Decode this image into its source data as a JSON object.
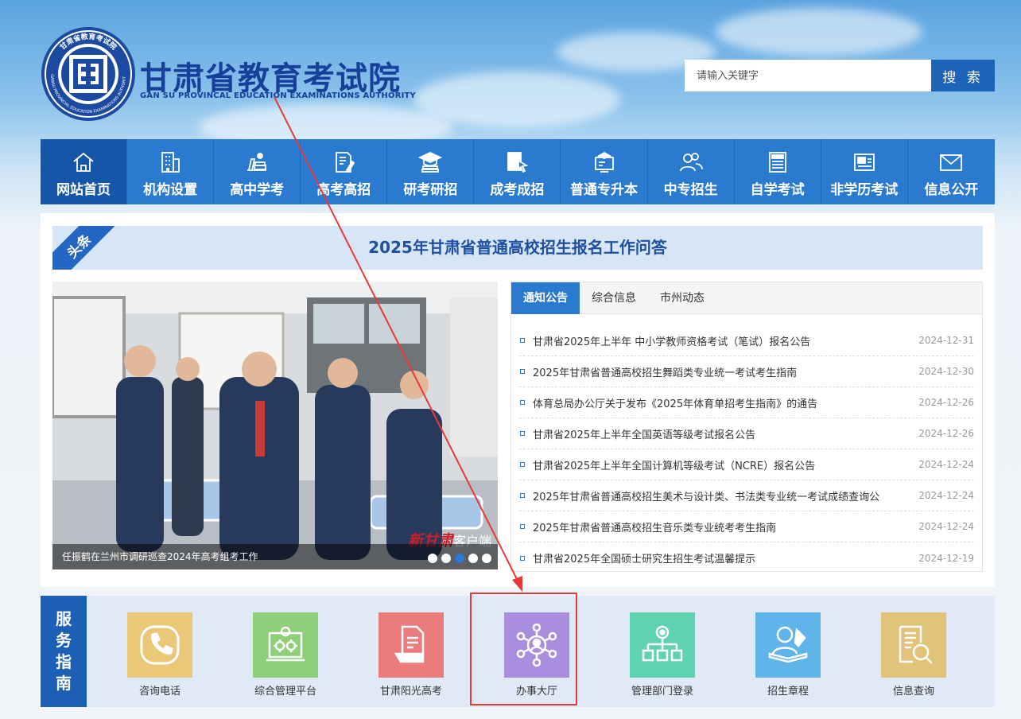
{
  "header": {
    "title": "甘肃省教育考试院",
    "subtitle": "GAN SU PROVINCAL EDUCATION EXAMINATIONS AUTHORITY",
    "seal_text_top": "甘肃省教育考试院",
    "seal_text_bottom": "GANSU PROVINCIAL EDUCATION EXAMINATIONS AUTHORITY"
  },
  "search": {
    "placeholder": "请输入关键字",
    "button_label": "搜 索"
  },
  "nav": [
    {
      "label": "网站首页",
      "icon": "home-icon"
    },
    {
      "label": "机构设置",
      "icon": "building-icon"
    },
    {
      "label": "高中学考",
      "icon": "books-icon"
    },
    {
      "label": "高考高招",
      "icon": "document-pen-icon"
    },
    {
      "label": "研考研招",
      "icon": "graduation-cap-icon"
    },
    {
      "label": "成考成招",
      "icon": "cursor-book-icon"
    },
    {
      "label": "普通专升本",
      "icon": "monitor-cap-icon"
    },
    {
      "label": "中专招生",
      "icon": "users-icon"
    },
    {
      "label": "自学考试",
      "icon": "newspaper-icon"
    },
    {
      "label": "非学历考试",
      "icon": "id-card-icon"
    },
    {
      "label": "信息公开",
      "icon": "envelope-icon"
    }
  ],
  "headline": {
    "tag": "头条",
    "text": "2025年甘肃省普通高校招生报名工作问答"
  },
  "slider": {
    "caption": "任振鹤在兰州市调研巡查2024年高考组考工作",
    "watermark_brand": "新甘肃",
    "watermark_suffix": "客户端",
    "dots": 5,
    "active_dot": 3
  },
  "news": {
    "tabs": [
      "通知公告",
      "综合信息",
      "市州动态"
    ],
    "active_tab": 0,
    "items": [
      {
        "title": "甘肃省2025年上半年 中小学教师资格考试（笔试）报名公告",
        "date": "2024-12-31"
      },
      {
        "title": "2025年甘肃省普通高校招生舞蹈类专业统一考试考生指南",
        "date": "2024-12-30"
      },
      {
        "title": "体育总局办公厅关于发布《2025年体育单招考生指南》的通告",
        "date": "2024-12-26"
      },
      {
        "title": "甘肃省2025年上半年全国英语等级考试报名公告",
        "date": "2024-12-26"
      },
      {
        "title": "甘肃省2025年上半年全国计算机等级考试（NCRE）报名公告",
        "date": "2024-12-24"
      },
      {
        "title": "2025年甘肃省普通高校招生美术与设计类、书法类专业统一考试成绩查询公",
        "date": "2024-12-24"
      },
      {
        "title": "2025年甘肃省普通高校招生音乐类专业统考考生指南",
        "date": "2024-12-24"
      },
      {
        "title": "甘肃省2025年全国硕士研究生招生考试温馨提示",
        "date": "2024-12-19"
      }
    ]
  },
  "service": {
    "label_chars": [
      "服",
      "务",
      "指",
      "南"
    ],
    "items": [
      {
        "label": "咨询电话",
        "icon": "phone-icon",
        "color": "#e9c877"
      },
      {
        "label": "综合管理平台",
        "icon": "gears-monitor-icon",
        "color": "#8fcf7a"
      },
      {
        "label": "甘肃阳光高考",
        "icon": "document-icon",
        "color": "#ec7b7b"
      },
      {
        "label": "办事大厅",
        "icon": "network-person-icon",
        "color": "#a98ee0"
      },
      {
        "label": "管理部门登录",
        "icon": "org-chart-icon",
        "color": "#5fd3b0"
      },
      {
        "label": "招生章程",
        "icon": "reader-icon",
        "color": "#5fb4ea"
      },
      {
        "label": "信息查询",
        "icon": "search-document-icon",
        "color": "#e2c37a"
      }
    ]
  },
  "colors": {
    "brand_blue": "#1c5fb4",
    "nav_blue": "#2a7ad0",
    "highlight_red": "#e53a3a"
  }
}
